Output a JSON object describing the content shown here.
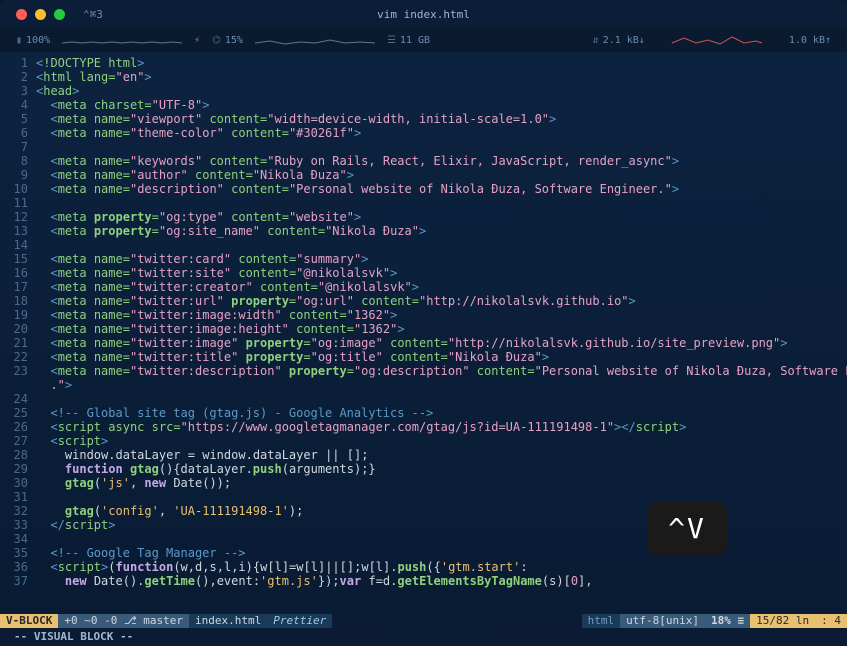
{
  "titlebar": {
    "tab": "⌃⌘3",
    "title": "vim index.html"
  },
  "topstats": {
    "battery_icon": "▮",
    "battery_pct": "100%",
    "bolt": "⚡",
    "fan_icon": "⌬",
    "fan_pct": "15%",
    "ram_icon": "☰",
    "ram": "11 GB",
    "net_down_icon": "⇵",
    "net_down": "2.1 kB↓",
    "net_up": "1.0 kB↑"
  },
  "code": [
    [
      [
        "c-bracket",
        "<"
      ],
      [
        "c-tag",
        "!DOCTYPE"
      ],
      [
        "",
        " "
      ],
      [
        "c-attr",
        "html"
      ],
      [
        "c-bracket",
        ">"
      ]
    ],
    [
      [
        "c-bracket",
        "<"
      ],
      [
        "c-tag",
        "html"
      ],
      [
        "",
        " "
      ],
      [
        "c-attr",
        "lang"
      ],
      [
        "c-eq",
        "="
      ],
      [
        "c-str",
        "\"en\""
      ],
      [
        "c-bracket",
        ">"
      ]
    ],
    [
      [
        "c-bracket",
        "<"
      ],
      [
        "c-tag",
        "head"
      ],
      [
        "c-bracket",
        ">"
      ]
    ],
    [
      [
        "",
        "  "
      ],
      [
        "c-bracket",
        "<"
      ],
      [
        "c-tag",
        "meta"
      ],
      [
        "",
        " "
      ],
      [
        "c-attr",
        "charset"
      ],
      [
        "c-eq",
        "="
      ],
      [
        "c-str",
        "\"UTF-8\""
      ],
      [
        "c-bracket",
        ">"
      ]
    ],
    [
      [
        "",
        "  "
      ],
      [
        "c-bracket",
        "<"
      ],
      [
        "c-tag",
        "meta"
      ],
      [
        "",
        " "
      ],
      [
        "c-attr",
        "name"
      ],
      [
        "c-eq",
        "="
      ],
      [
        "c-str",
        "\"viewport\""
      ],
      [
        "",
        " "
      ],
      [
        "c-attr",
        "content"
      ],
      [
        "c-eq",
        "="
      ],
      [
        "c-str",
        "\"width=device-width, initial-scale=1.0\""
      ],
      [
        "c-bracket",
        ">"
      ]
    ],
    [
      [
        "",
        "  "
      ],
      [
        "c-bracket",
        "<"
      ],
      [
        "c-tag",
        "meta"
      ],
      [
        "",
        " "
      ],
      [
        "c-attr",
        "name"
      ],
      [
        "c-eq",
        "="
      ],
      [
        "c-str",
        "\"theme-color\""
      ],
      [
        "",
        " "
      ],
      [
        "c-attr",
        "content"
      ],
      [
        "c-eq",
        "="
      ],
      [
        "c-str",
        "\"#30261f\""
      ],
      [
        "c-bracket",
        ">"
      ]
    ],
    [],
    [
      [
        "",
        "  "
      ],
      [
        "c-bracket",
        "<"
      ],
      [
        "c-tag",
        "meta"
      ],
      [
        "",
        " "
      ],
      [
        "c-attr",
        "name"
      ],
      [
        "c-eq",
        "="
      ],
      [
        "c-str",
        "\"keywords\""
      ],
      [
        "",
        " "
      ],
      [
        "c-attr",
        "content"
      ],
      [
        "c-eq",
        "="
      ],
      [
        "c-str",
        "\"Ruby on Rails, React, Elixir, JavaScript, render_async\""
      ],
      [
        "c-bracket",
        ">"
      ]
    ],
    [
      [
        "",
        "  "
      ],
      [
        "c-bracket",
        "<"
      ],
      [
        "c-tag",
        "meta"
      ],
      [
        "",
        " "
      ],
      [
        "c-attr",
        "name"
      ],
      [
        "c-eq",
        "="
      ],
      [
        "c-str",
        "\"author\""
      ],
      [
        "",
        " "
      ],
      [
        "c-attr",
        "content"
      ],
      [
        "c-eq",
        "="
      ],
      [
        "c-str",
        "\"Nikola Đuza\""
      ],
      [
        "c-bracket",
        ">"
      ]
    ],
    [
      [
        "",
        "  "
      ],
      [
        "c-bracket",
        "<"
      ],
      [
        "c-tag",
        "meta"
      ],
      [
        "",
        " "
      ],
      [
        "c-attr",
        "name"
      ],
      [
        "c-eq",
        "="
      ],
      [
        "c-str",
        "\"description\""
      ],
      [
        "",
        " "
      ],
      [
        "c-attr",
        "content"
      ],
      [
        "c-eq",
        "="
      ],
      [
        "c-str",
        "\"Personal website of Nikola Đuza, Software Engineer.\""
      ],
      [
        "c-bracket",
        ">"
      ]
    ],
    [],
    [
      [
        "",
        "  "
      ],
      [
        "c-bracket",
        "<"
      ],
      [
        "c-tag",
        "meta"
      ],
      [
        "",
        " "
      ],
      [
        "c-attr-l",
        "property"
      ],
      [
        "c-eq",
        "="
      ],
      [
        "c-str",
        "\"og:type\""
      ],
      [
        "",
        " "
      ],
      [
        "c-attr",
        "content"
      ],
      [
        "c-eq",
        "="
      ],
      [
        "c-str",
        "\"website\""
      ],
      [
        "c-bracket",
        ">"
      ]
    ],
    [
      [
        "",
        "  "
      ],
      [
        "c-bracket",
        "<"
      ],
      [
        "c-tag",
        "meta"
      ],
      [
        "",
        " "
      ],
      [
        "c-attr-l",
        "property"
      ],
      [
        "c-eq",
        "="
      ],
      [
        "c-str",
        "\"og:site_name\""
      ],
      [
        "",
        " "
      ],
      [
        "c-attr",
        "content"
      ],
      [
        "c-eq",
        "="
      ],
      [
        "c-str",
        "\"Nikola Đuza\""
      ],
      [
        "c-bracket",
        ">"
      ]
    ],
    [],
    [
      [
        "",
        "  "
      ],
      [
        "c-bracket",
        "<"
      ],
      [
        "c-tag",
        "meta"
      ],
      [
        "",
        " "
      ],
      [
        "c-attr",
        "name"
      ],
      [
        "c-eq",
        "="
      ],
      [
        "c-str",
        "\"twitter:card\""
      ],
      [
        "",
        " "
      ],
      [
        "c-attr",
        "content"
      ],
      [
        "c-eq",
        "="
      ],
      [
        "c-str",
        "\"summary\""
      ],
      [
        "c-bracket",
        ">"
      ]
    ],
    [
      [
        "",
        "  "
      ],
      [
        "c-bracket",
        "<"
      ],
      [
        "c-tag",
        "meta"
      ],
      [
        "",
        " "
      ],
      [
        "c-attr",
        "name"
      ],
      [
        "c-eq",
        "="
      ],
      [
        "c-str",
        "\"twitter:site\""
      ],
      [
        "",
        " "
      ],
      [
        "c-attr",
        "content"
      ],
      [
        "c-eq",
        "="
      ],
      [
        "c-str",
        "\"@nikolalsvk\""
      ],
      [
        "c-bracket",
        ">"
      ]
    ],
    [
      [
        "",
        "  "
      ],
      [
        "c-bracket",
        "<"
      ],
      [
        "c-tag",
        "meta"
      ],
      [
        "",
        " "
      ],
      [
        "c-attr",
        "name"
      ],
      [
        "c-eq",
        "="
      ],
      [
        "c-str",
        "\"twitter:creator\""
      ],
      [
        "",
        " "
      ],
      [
        "c-attr",
        "content"
      ],
      [
        "c-eq",
        "="
      ],
      [
        "c-str",
        "\"@nikolalsvk\""
      ],
      [
        "c-bracket",
        ">"
      ]
    ],
    [
      [
        "",
        "  "
      ],
      [
        "c-bracket",
        "<"
      ],
      [
        "c-tag",
        "meta"
      ],
      [
        "",
        " "
      ],
      [
        "c-attr",
        "name"
      ],
      [
        "c-eq",
        "="
      ],
      [
        "c-str",
        "\"twitter:url\""
      ],
      [
        "",
        " "
      ],
      [
        "c-attr-l",
        "property"
      ],
      [
        "c-eq",
        "="
      ],
      [
        "c-str",
        "\"og:url\""
      ],
      [
        "",
        " "
      ],
      [
        "c-attr",
        "content"
      ],
      [
        "c-eq",
        "="
      ],
      [
        "c-str",
        "\"http://nikolalsvk.github.io\""
      ],
      [
        "c-bracket",
        ">"
      ]
    ],
    [
      [
        "",
        "  "
      ],
      [
        "c-bracket",
        "<"
      ],
      [
        "c-tag",
        "meta"
      ],
      [
        "",
        " "
      ],
      [
        "c-attr",
        "name"
      ],
      [
        "c-eq",
        "="
      ],
      [
        "c-str",
        "\"twitter:image:width\""
      ],
      [
        "",
        " "
      ],
      [
        "c-attr",
        "content"
      ],
      [
        "c-eq",
        "="
      ],
      [
        "c-str",
        "\"1362\""
      ],
      [
        "c-bracket",
        ">"
      ]
    ],
    [
      [
        "",
        "  "
      ],
      [
        "c-bracket",
        "<"
      ],
      [
        "c-tag",
        "meta"
      ],
      [
        "",
        " "
      ],
      [
        "c-attr",
        "name"
      ],
      [
        "c-eq",
        "="
      ],
      [
        "c-str",
        "\"twitter:image:height\""
      ],
      [
        "",
        " "
      ],
      [
        "c-attr",
        "content"
      ],
      [
        "c-eq",
        "="
      ],
      [
        "c-str",
        "\"1362\""
      ],
      [
        "c-bracket",
        ">"
      ]
    ],
    [
      [
        "",
        "  "
      ],
      [
        "c-bracket",
        "<"
      ],
      [
        "c-tag",
        "meta"
      ],
      [
        "",
        " "
      ],
      [
        "c-attr",
        "name"
      ],
      [
        "c-eq",
        "="
      ],
      [
        "c-str",
        "\"twitter:image\""
      ],
      [
        "",
        " "
      ],
      [
        "c-attr-l",
        "property"
      ],
      [
        "c-eq",
        "="
      ],
      [
        "c-str",
        "\"og:image\""
      ],
      [
        "",
        " "
      ],
      [
        "c-attr",
        "content"
      ],
      [
        "c-eq",
        "="
      ],
      [
        "c-str",
        "\"http://nikolalsvk.github.io/site_preview.png\""
      ],
      [
        "c-bracket",
        ">"
      ]
    ],
    [
      [
        "",
        "  "
      ],
      [
        "c-bracket",
        "<"
      ],
      [
        "c-tag",
        "meta"
      ],
      [
        "",
        " "
      ],
      [
        "c-attr",
        "name"
      ],
      [
        "c-eq",
        "="
      ],
      [
        "c-str",
        "\"twitter:title\""
      ],
      [
        "",
        " "
      ],
      [
        "c-attr-l",
        "property"
      ],
      [
        "c-eq",
        "="
      ],
      [
        "c-str",
        "\"og:title\""
      ],
      [
        "",
        " "
      ],
      [
        "c-attr",
        "content"
      ],
      [
        "c-eq",
        "="
      ],
      [
        "c-str",
        "\"Nikola Đuza\""
      ],
      [
        "c-bracket",
        ">"
      ]
    ],
    [
      [
        "",
        "  "
      ],
      [
        "c-bracket",
        "<"
      ],
      [
        "c-tag",
        "meta"
      ],
      [
        "",
        " "
      ],
      [
        "c-attr",
        "name"
      ],
      [
        "c-eq",
        "="
      ],
      [
        "c-str",
        "\"twitter:description\""
      ],
      [
        "",
        " "
      ],
      [
        "c-attr-l",
        "property"
      ],
      [
        "c-eq",
        "="
      ],
      [
        "c-str",
        "\"og:description\""
      ],
      [
        "",
        " "
      ],
      [
        "c-attr",
        "content"
      ],
      [
        "c-eq",
        "="
      ],
      [
        "c-str",
        "\"Personal website of Nikola Đuza, Software Engineer"
      ]
    ],
    [
      [
        "c-str",
        "  .\""
      ],
      [
        "c-bracket",
        ">"
      ]
    ],
    [],
    [
      [
        "",
        "  "
      ],
      [
        "c-cmt",
        "<!-- Global site tag (gtag.js) - Google Analytics -->"
      ]
    ],
    [
      [
        "",
        "  "
      ],
      [
        "c-bracket",
        "<"
      ],
      [
        "c-tag",
        "script"
      ],
      [
        "",
        " "
      ],
      [
        "c-attr",
        "async"
      ],
      [
        "",
        " "
      ],
      [
        "c-attr",
        "src"
      ],
      [
        "c-eq",
        "="
      ],
      [
        "c-str",
        "\"https://www.googletagmanager.com/gtag/js?id=UA-111191498-1\""
      ],
      [
        "c-bracket",
        "></"
      ],
      [
        "c-tag",
        "script"
      ],
      [
        "c-bracket",
        ">"
      ]
    ],
    [
      [
        "",
        "  "
      ],
      [
        "c-bracket",
        "<"
      ],
      [
        "c-tag",
        "script"
      ],
      [
        "c-bracket",
        ">"
      ]
    ],
    [
      [
        "",
        "    "
      ],
      [
        "c-id",
        "window"
      ],
      [
        "c-punc",
        "."
      ],
      [
        "c-id",
        "dataLayer"
      ],
      [
        "c-punc",
        " = "
      ],
      [
        "c-id",
        "window"
      ],
      [
        "c-punc",
        "."
      ],
      [
        "c-id",
        "dataLayer"
      ],
      [
        "c-punc",
        " || [];"
      ]
    ],
    [
      [
        "",
        "    "
      ],
      [
        "c-kw",
        "function"
      ],
      [
        "c-punc",
        " "
      ],
      [
        "c-fn",
        "gtag"
      ],
      [
        "c-punc",
        "(){"
      ],
      [
        "c-id",
        "dataLayer"
      ],
      [
        "c-punc",
        "."
      ],
      [
        "c-fn",
        "push"
      ],
      [
        "c-punc",
        "("
      ],
      [
        "c-id",
        "arguments"
      ],
      [
        "c-punc",
        ");}"
      ]
    ],
    [
      [
        "",
        "    "
      ],
      [
        "c-fn",
        "gtag"
      ],
      [
        "c-punc",
        "("
      ],
      [
        "c-str-y",
        "'js'"
      ],
      [
        "c-punc",
        ", "
      ],
      [
        "c-kw",
        "new"
      ],
      [
        "c-punc",
        " "
      ],
      [
        "c-id",
        "Date"
      ],
      [
        "c-punc",
        "());"
      ]
    ],
    [],
    [
      [
        "",
        "    "
      ],
      [
        "c-fn",
        "gtag"
      ],
      [
        "c-punc",
        "("
      ],
      [
        "c-str-y",
        "'config'"
      ],
      [
        "c-punc",
        ", "
      ],
      [
        "c-str-y",
        "'UA-111191498-1'"
      ],
      [
        "c-punc",
        ");"
      ]
    ],
    [
      [
        "",
        "  "
      ],
      [
        "c-bracket",
        "</"
      ],
      [
        "c-tag",
        "script"
      ],
      [
        "c-bracket",
        ">"
      ]
    ],
    [],
    [
      [
        "",
        "  "
      ],
      [
        "c-cmt",
        "<!-- Google Tag Manager -->"
      ]
    ],
    [
      [
        "",
        "  "
      ],
      [
        "c-bracket",
        "<"
      ],
      [
        "c-tag",
        "script"
      ],
      [
        "c-bracket",
        ">"
      ],
      [
        "c-punc",
        "("
      ],
      [
        "c-kw",
        "function"
      ],
      [
        "c-punc",
        "("
      ],
      [
        "c-id",
        "w"
      ],
      [
        "c-punc",
        ","
      ],
      [
        "c-id",
        "d"
      ],
      [
        "c-punc",
        ","
      ],
      [
        "c-id",
        "s"
      ],
      [
        "c-punc",
        ","
      ],
      [
        "c-id",
        "l"
      ],
      [
        "c-punc",
        ","
      ],
      [
        "c-id",
        "i"
      ],
      [
        "c-punc",
        "){"
      ],
      [
        "c-id",
        "w"
      ],
      [
        "c-punc",
        "["
      ],
      [
        "c-id",
        "l"
      ],
      [
        "c-punc",
        "]="
      ],
      [
        "c-id",
        "w"
      ],
      [
        "c-punc",
        "["
      ],
      [
        "c-id",
        "l"
      ],
      [
        "c-punc",
        "]||[];"
      ],
      [
        "c-id",
        "w"
      ],
      [
        "c-punc",
        "["
      ],
      [
        "c-id",
        "l"
      ],
      [
        "c-punc",
        "]."
      ],
      [
        "c-fn",
        "push"
      ],
      [
        "c-punc",
        "({"
      ],
      [
        "c-str-y",
        "'gtm.start'"
      ],
      [
        "c-punc",
        ":"
      ]
    ],
    [
      [
        "",
        "    "
      ],
      [
        "c-kw",
        "new"
      ],
      [
        "c-punc",
        " "
      ],
      [
        "c-id",
        "Date"
      ],
      [
        "c-punc",
        "()."
      ],
      [
        "c-fn",
        "getTime"
      ],
      [
        "c-punc",
        "(),"
      ],
      [
        "c-id",
        "event"
      ],
      [
        "c-punc",
        ":"
      ],
      [
        "c-str-y",
        "'gtm.js'"
      ],
      [
        "c-punc",
        "});"
      ],
      [
        "c-kw",
        "var"
      ],
      [
        "c-punc",
        " "
      ],
      [
        "c-id",
        "f"
      ],
      [
        "c-punc",
        "="
      ],
      [
        "c-id",
        "d"
      ],
      [
        "c-punc",
        "."
      ],
      [
        "c-fn",
        "getElementsByTagName"
      ],
      [
        "c-punc",
        "("
      ],
      [
        "c-id",
        "s"
      ],
      [
        "c-punc",
        ")["
      ],
      [
        "c-num",
        "0"
      ],
      [
        "c-punc",
        "],"
      ]
    ]
  ],
  "line_wrap_index": 23,
  "statusline": {
    "mode": "V-BLOCK",
    "git": " +0 ~0 -0 ⎇ master ",
    "file": " index.html ",
    "prettier": " Prettier ",
    "filetype": " html ",
    "encoding": " utf-8[unix] ",
    "percent": " 18% ≡ ",
    "position": " 15/82 ln ",
    "col": ":  4 "
  },
  "cmdline": "-- VISUAL BLOCK --",
  "overlay": "^V"
}
